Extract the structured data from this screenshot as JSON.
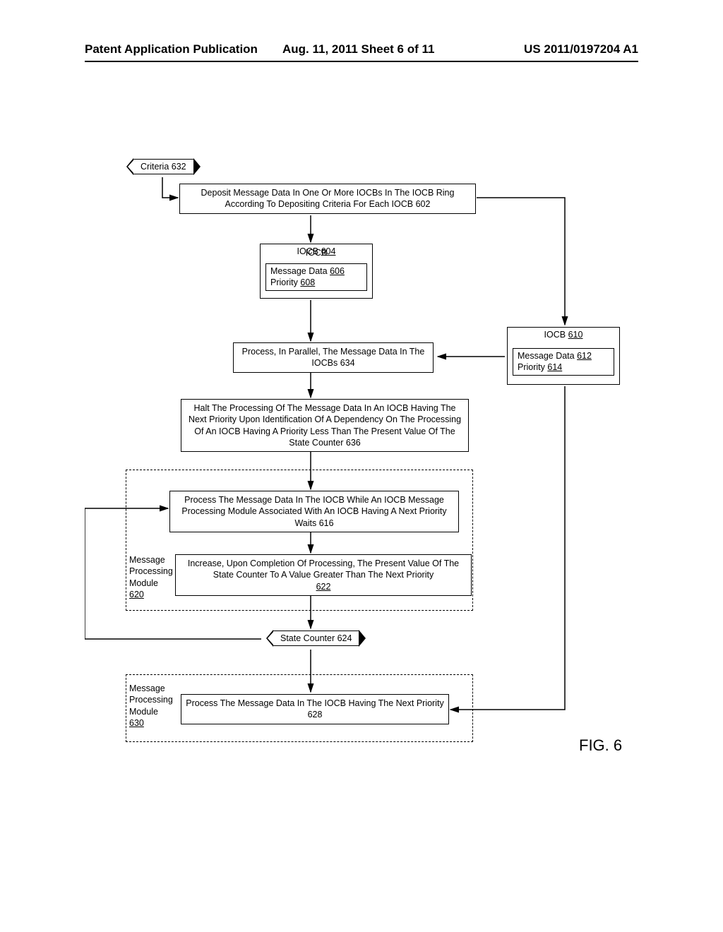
{
  "header": {
    "left": "Patent Application Publication",
    "middle": "Aug. 11, 2011  Sheet 6 of 11",
    "right": "US 2011/0197204 A1"
  },
  "criteria_tag": "Criteria 632",
  "box_deposit": "Deposit Message Data In One Or More IOCBs In The IOCB Ring According To Depositing Criteria For Each IOCB 602",
  "iocb604": {
    "title": "IOCB 604",
    "msg": "Message Data 606",
    "prio": "Priority 608"
  },
  "iocb610": {
    "title": "IOCB 610",
    "msg": "Message Data 612",
    "prio": "Priority 614"
  },
  "box_process_parallel": "Process, In Parallel, The Message Data In The IOCBs 634",
  "box_halt": "Halt The Processing Of The Message Data In An IOCB Having The Next Priority Upon Identification Of A Dependency On The Processing Of An IOCB Having A Priority Less Than The Present Value Of The State Counter 636",
  "box_process_while": "Process The Message Data In The IOCB While An IOCB Message Processing Module Associated With An IOCB Having A Next Priority Waits 616",
  "box_increase": "Increase, Upon Completion Of Processing, The Present Value Of The State Counter To A Value Greater Than The Next Priority",
  "box_increase_num": "622",
  "module620": "Message\nProcessing\nModule\n620",
  "state_counter_tag": "State Counter 624",
  "box_process_next": "Process The Message Data In The IOCB Having The Next Priority 628",
  "module630": "Message\nProcessing\nModule\n630",
  "fig_label": "FIG. 6"
}
